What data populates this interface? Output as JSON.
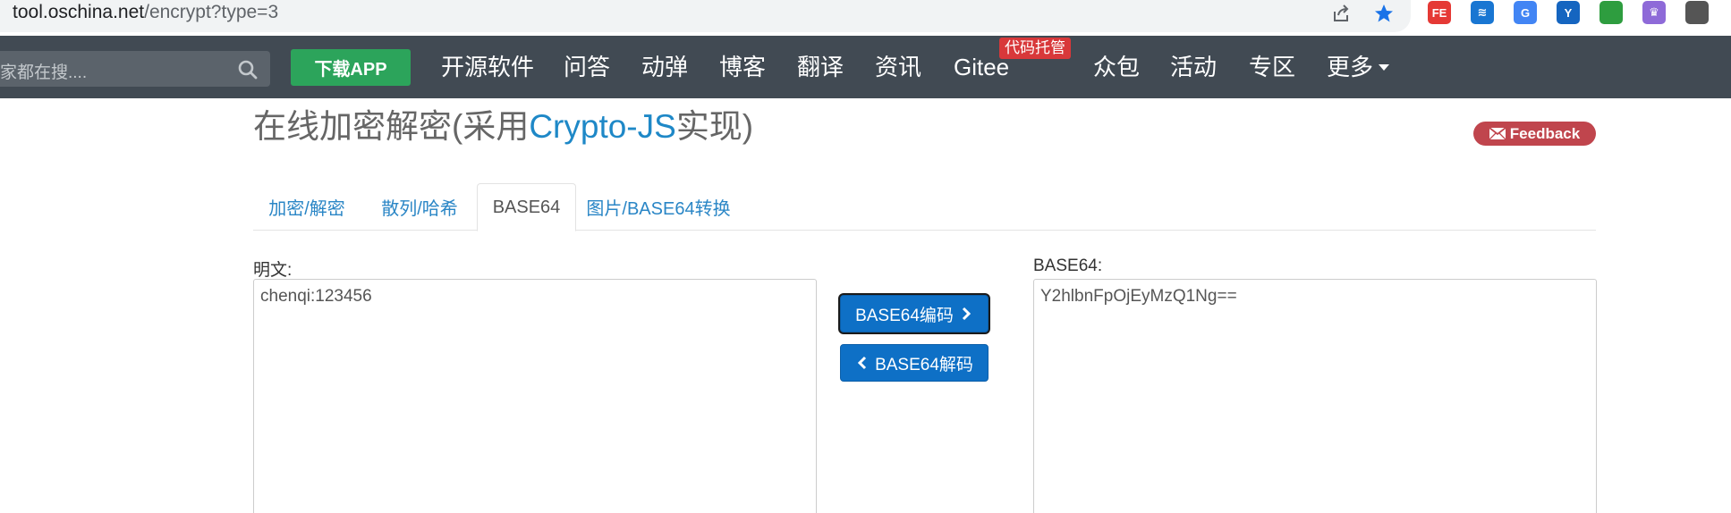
{
  "browser": {
    "url_host": "tool.oschina.net",
    "url_path": "/encrypt?type=3",
    "icons": [
      "share-icon",
      "bookmark-star-icon"
    ],
    "extensions": [
      {
        "name": "fe-helper-extension-icon",
        "label": "FE",
        "color": "#e53935"
      },
      {
        "name": "layers-extension-icon",
        "label": "≋",
        "color": "#1976d2"
      },
      {
        "name": "google-translate-extension-icon",
        "label": "G",
        "color": "#4285f4"
      },
      {
        "name": "y-extension-icon",
        "label": "Y",
        "color": "#1565c0"
      },
      {
        "name": "tag-extension-icon",
        "label": "",
        "color": "#2e9d3f"
      },
      {
        "name": "crown-extension-icon",
        "label": "♛",
        "color": "#8e6ad8"
      },
      {
        "name": "apps-extension-icon",
        "label": "",
        "color": "#555555"
      }
    ]
  },
  "navbar": {
    "search_placeholder": "家都在搜....",
    "download_label": "下载APP",
    "items": [
      "开源软件",
      "问答",
      "动弹",
      "博客",
      "翻译",
      "资讯",
      "Gitee",
      "众包",
      "活动",
      "专区",
      "更多"
    ],
    "gitee_badge": "代码托管",
    "colors": {
      "bar": "#414a53",
      "download": "#2ca45b",
      "badge": "#d8383a"
    }
  },
  "page": {
    "title_prefix": "在线加密解密(采用",
    "title_brand": "Crypto-JS",
    "title_suffix": "实现)",
    "feedback_label": "Feedback",
    "tabs": [
      {
        "label": "加密/解密",
        "active": false
      },
      {
        "label": "散列/哈希",
        "active": false
      },
      {
        "label": "BASE64",
        "active": true
      },
      {
        "label": "图片/BASE64转换",
        "active": false
      }
    ],
    "plaintext_label": "明文:",
    "plaintext_value": "chenqi:123456",
    "base64_label": "BASE64:",
    "base64_value": "Y2hlbnFpOjEyMzQ1Ng==",
    "encode_button": "BASE64编码",
    "decode_button": "BASE64解码",
    "colors": {
      "link": "#2a86c6",
      "button": "#0e70c6",
      "feedback": "#c0454d"
    }
  }
}
